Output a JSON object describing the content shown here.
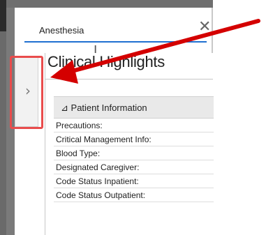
{
  "search": {
    "value": "Anesthesia",
    "clear_glyph": "✕"
  },
  "cursor_glyph": "I",
  "expand_tab": {
    "glyph": "›",
    "icon": "chevron-right-icon"
  },
  "panel": {
    "title": "Clinical Highlights",
    "section": {
      "toggle_glyph": "⊿",
      "label": "Patient Information"
    },
    "rows": [
      "Precautions:",
      "Critical Management Info:",
      "Blood Type:",
      "Designated Caregiver:",
      "Code Status Inpatient:",
      "Code Status Outpatient:"
    ]
  },
  "colors": {
    "annotation_red": "#d40000",
    "highlight_box": "#e94c4c",
    "focus_underline": "#1f6fd1"
  }
}
